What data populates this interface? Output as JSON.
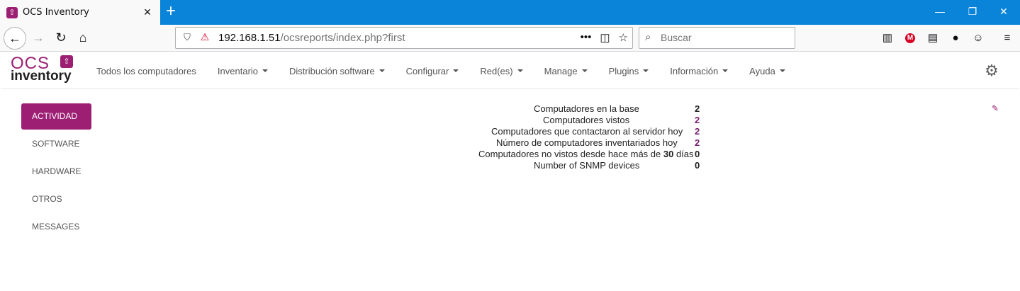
{
  "browser": {
    "tab_title": "OCS Inventory",
    "url_host": "192.168.1.51",
    "url_path": "/ocsreports/index.php?first",
    "search_placeholder": "Buscar",
    "accent": "#0a84d9"
  },
  "app": {
    "logo_top": "OCS",
    "logo_bottom": "inventory",
    "brand_color": "#9c1f74",
    "menu": [
      {
        "label": "Todos los computadores",
        "dropdown": false
      },
      {
        "label": "Inventario",
        "dropdown": true
      },
      {
        "label": "Distribución software",
        "dropdown": true
      },
      {
        "label": "Configurar",
        "dropdown": true
      },
      {
        "label": "Red(es)",
        "dropdown": true
      },
      {
        "label": "Manage",
        "dropdown": true
      },
      {
        "label": "Plugins",
        "dropdown": true
      },
      {
        "label": "Información",
        "dropdown": true
      },
      {
        "label": "Ayuda",
        "dropdown": true
      }
    ]
  },
  "sidebar": {
    "items": [
      {
        "label": "ACTIVIDAD",
        "active": true
      },
      {
        "label": "SOFTWARE",
        "active": false
      },
      {
        "label": "HARDWARE",
        "active": false
      },
      {
        "label": "OTROS",
        "active": false
      },
      {
        "label": "MESSAGES",
        "active": false
      }
    ]
  },
  "stats": [
    {
      "label": "Computadores en la base",
      "value": "2",
      "link": false
    },
    {
      "label": "Computadores vistos",
      "value": "2",
      "link": true
    },
    {
      "label": "Computadores que contactaron al servidor hoy",
      "value": "2",
      "link": true
    },
    {
      "label": "Número de computadores inventariados hoy",
      "value": "2",
      "link": true
    },
    {
      "label_pre": "Computadores no vistos desde hace más de ",
      "label_bold": "30",
      "label_post": " días",
      "value": "0",
      "link": false
    },
    {
      "label": "Number of SNMP devices",
      "value": "0",
      "link": false
    }
  ]
}
